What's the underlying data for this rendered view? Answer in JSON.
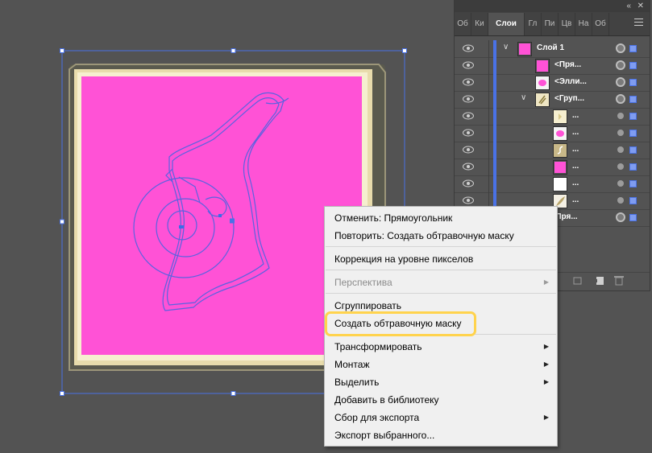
{
  "colors": {
    "canvas_bg": "#535353",
    "artboard_shadow": "#5a5a4e",
    "frame_cream": "#e8dcac",
    "pink_fill": "#ff52d6",
    "selection_blue": "#4a72e6",
    "highlight_yellow": "#ffd34d"
  },
  "panel": {
    "collapse_icon": "double-chevron-right",
    "close_icon": "close",
    "menu_icon": "hamburger",
    "tabs": [
      {
        "label": "Об"
      },
      {
        "label": "Ки"
      },
      {
        "label": "Слои",
        "active": true
      },
      {
        "label": "Гл"
      },
      {
        "label": "Пи"
      },
      {
        "label": "Цв"
      },
      {
        "label": "На"
      },
      {
        "label": "Об"
      }
    ],
    "layers": [
      {
        "name": "Слой 1",
        "thumb": "pink-square",
        "expanded": true,
        "level": 0
      },
      {
        "name": "<Пря...",
        "thumb": "pink-square",
        "level": 1
      },
      {
        "name": "<Элли...",
        "thumb": "pink-ellipse",
        "level": 1
      },
      {
        "name": "<Груп...",
        "thumb": "drawing",
        "expanded": true,
        "level": 1
      },
      {
        "name": "...",
        "thumb": "cream-star",
        "level": 2
      },
      {
        "name": "...",
        "thumb": "pink-ellipse",
        "level": 2
      },
      {
        "name": "...",
        "thumb": "gold-swirl",
        "level": 2
      },
      {
        "name": "...",
        "thumb": "pink-square",
        "level": 2
      },
      {
        "name": "...",
        "thumb": "white-shape",
        "level": 2
      },
      {
        "name": "...",
        "thumb": "feather",
        "level": 2
      },
      {
        "name": ":Пря...",
        "thumb": "none",
        "level": 1
      }
    ]
  },
  "context_menu": {
    "items": [
      {
        "label": "Отменить: Прямоугольник"
      },
      {
        "label": "Повторить: Создать обтравочную маску"
      },
      {
        "label": "Коррекция на уровне пикселов"
      },
      {
        "label": "Перспектива",
        "submenu": true,
        "disabled": true
      },
      {
        "label": "Сгруппировать"
      },
      {
        "label": "Создать обтравочную маску",
        "highlighted": true
      },
      {
        "label": "Трансформировать",
        "submenu": true
      },
      {
        "label": "Монтаж",
        "submenu": true
      },
      {
        "label": "Выделить",
        "submenu": true
      },
      {
        "label": "Добавить в библиотеку"
      },
      {
        "label": "Сбор для экспорта",
        "submenu": true
      },
      {
        "label": "Экспорт выбранного..."
      }
    ]
  }
}
